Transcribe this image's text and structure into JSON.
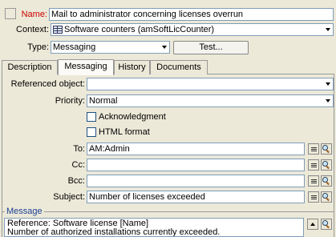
{
  "header": {
    "name_label": "Name:",
    "name_value": "Mail to administrator concerning licenses overrun",
    "context_label": "Context:",
    "context_value": "Software counters (amSoftLicCounter)",
    "type_label": "Type:",
    "type_value": "Messaging",
    "test_button": "Test..."
  },
  "tabs": [
    {
      "label": "Description",
      "active": false
    },
    {
      "label": "Messaging",
      "active": true
    },
    {
      "label": "History",
      "active": false
    },
    {
      "label": "Documents",
      "active": false
    }
  ],
  "messaging": {
    "referenced_label": "Referenced object:",
    "referenced_value": "",
    "priority_label": "Priority:",
    "priority_value": "Normal",
    "acknowledgment_label": "Acknowledgment",
    "acknowledgment_checked": false,
    "html_label": "HTML format",
    "html_checked": false,
    "to_label": "To:",
    "to_value": "AM:Admin",
    "cc_label": "Cc:",
    "cc_value": "",
    "bcc_label": "Bcc:",
    "bcc_value": "",
    "subject_label": "Subject:",
    "subject_value": "Number of licenses exceeded",
    "message_group_label": "Message",
    "message_lines": [
      "Reference: Software license [Name]",
      "Number of authorized installations currently exceeded."
    ]
  },
  "colors": {
    "name_label": "#cc0000",
    "field_border": "#7f9db9",
    "message_label": "#1c3f94"
  }
}
